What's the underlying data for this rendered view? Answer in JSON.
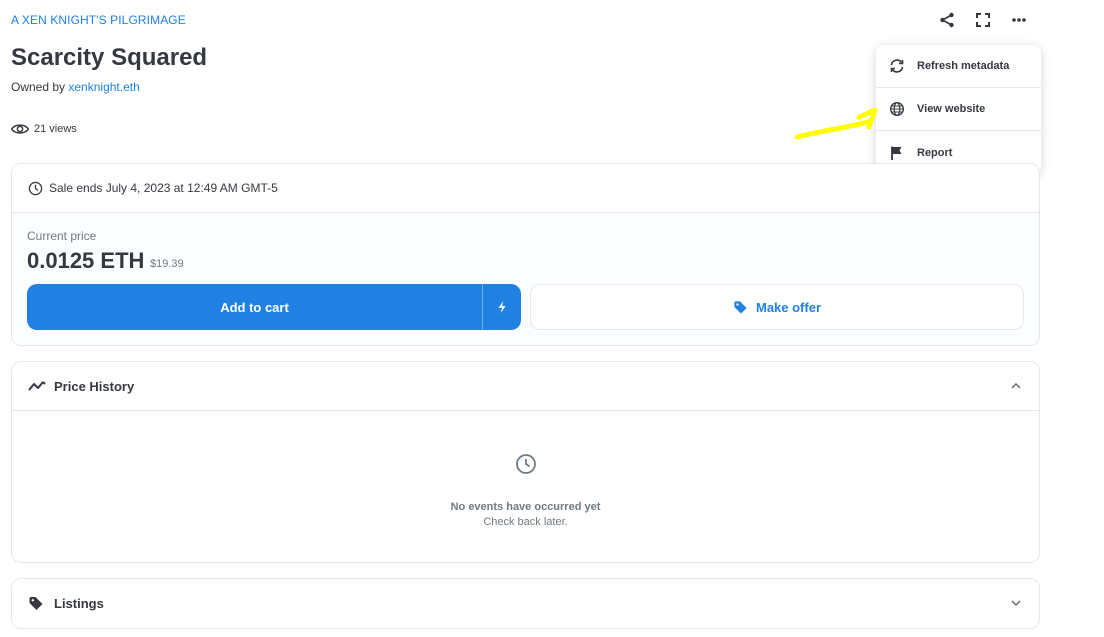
{
  "collection": {
    "name": "A XEN KNIGHT'S PILGRIMAGE"
  },
  "item": {
    "title": "Scarcity Squared",
    "owned_by_label": "Owned by",
    "owner": "xenknight.eth",
    "views": "21 views"
  },
  "menu": {
    "items": [
      {
        "label": "Refresh metadata",
        "icon": "refresh-icon"
      },
      {
        "label": "View website",
        "icon": "globe-icon"
      },
      {
        "label": "Report",
        "icon": "flag-icon"
      }
    ]
  },
  "sale": {
    "ends_text": "Sale ends July 4, 2023 at 12:49 AM GMT-5",
    "current_price_label": "Current price",
    "price_eth": "0.0125 ETH",
    "price_usd": "$19.39",
    "add_to_cart_label": "Add to cart",
    "make_offer_label": "Make offer"
  },
  "price_history": {
    "title": "Price History",
    "empty_title": "No events have occurred yet",
    "empty_subtitle": "Check back later."
  },
  "listings": {
    "title": "Listings"
  },
  "colors": {
    "accent": "#2081e2",
    "text": "#353840",
    "muted": "#707a83",
    "border": "#e5e8eb",
    "annotation": "#ffff00"
  }
}
